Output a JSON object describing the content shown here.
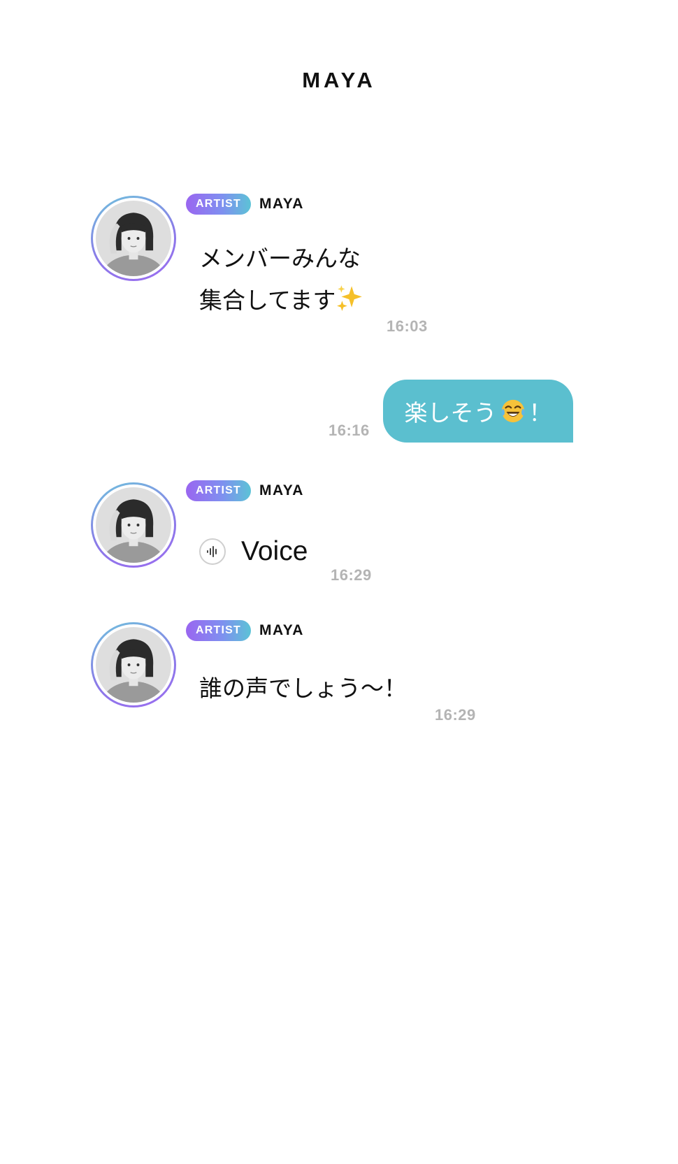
{
  "header": {
    "title": "MAYA"
  },
  "colors": {
    "accent_teal": "#5bbfcf",
    "badge_gradient_start": "#9a66f0",
    "badge_gradient_end": "#5cc3d6",
    "timestamp_gray": "#b4b4b4",
    "text_dark": "#111111"
  },
  "messages": [
    {
      "type": "incoming_text",
      "badge": "ARTIST",
      "sender": "MAYA",
      "lines": [
        "メンバーみんな",
        "集合してます"
      ],
      "emoji": "sparkles-emoji",
      "time": "16:03"
    },
    {
      "type": "outgoing_text",
      "text": "楽しそう",
      "emoji": "tears-of-joy-emoji",
      "suffix": "！",
      "time": "16:16"
    },
    {
      "type": "incoming_voice",
      "badge": "ARTIST",
      "sender": "MAYA",
      "icon": "voice-waveform-icon",
      "label": "Voice",
      "time": "16:29"
    },
    {
      "type": "incoming_text",
      "badge": "ARTIST",
      "sender": "MAYA",
      "lines": [
        "誰の声でしょう～！"
      ],
      "time": "16:29"
    }
  ]
}
